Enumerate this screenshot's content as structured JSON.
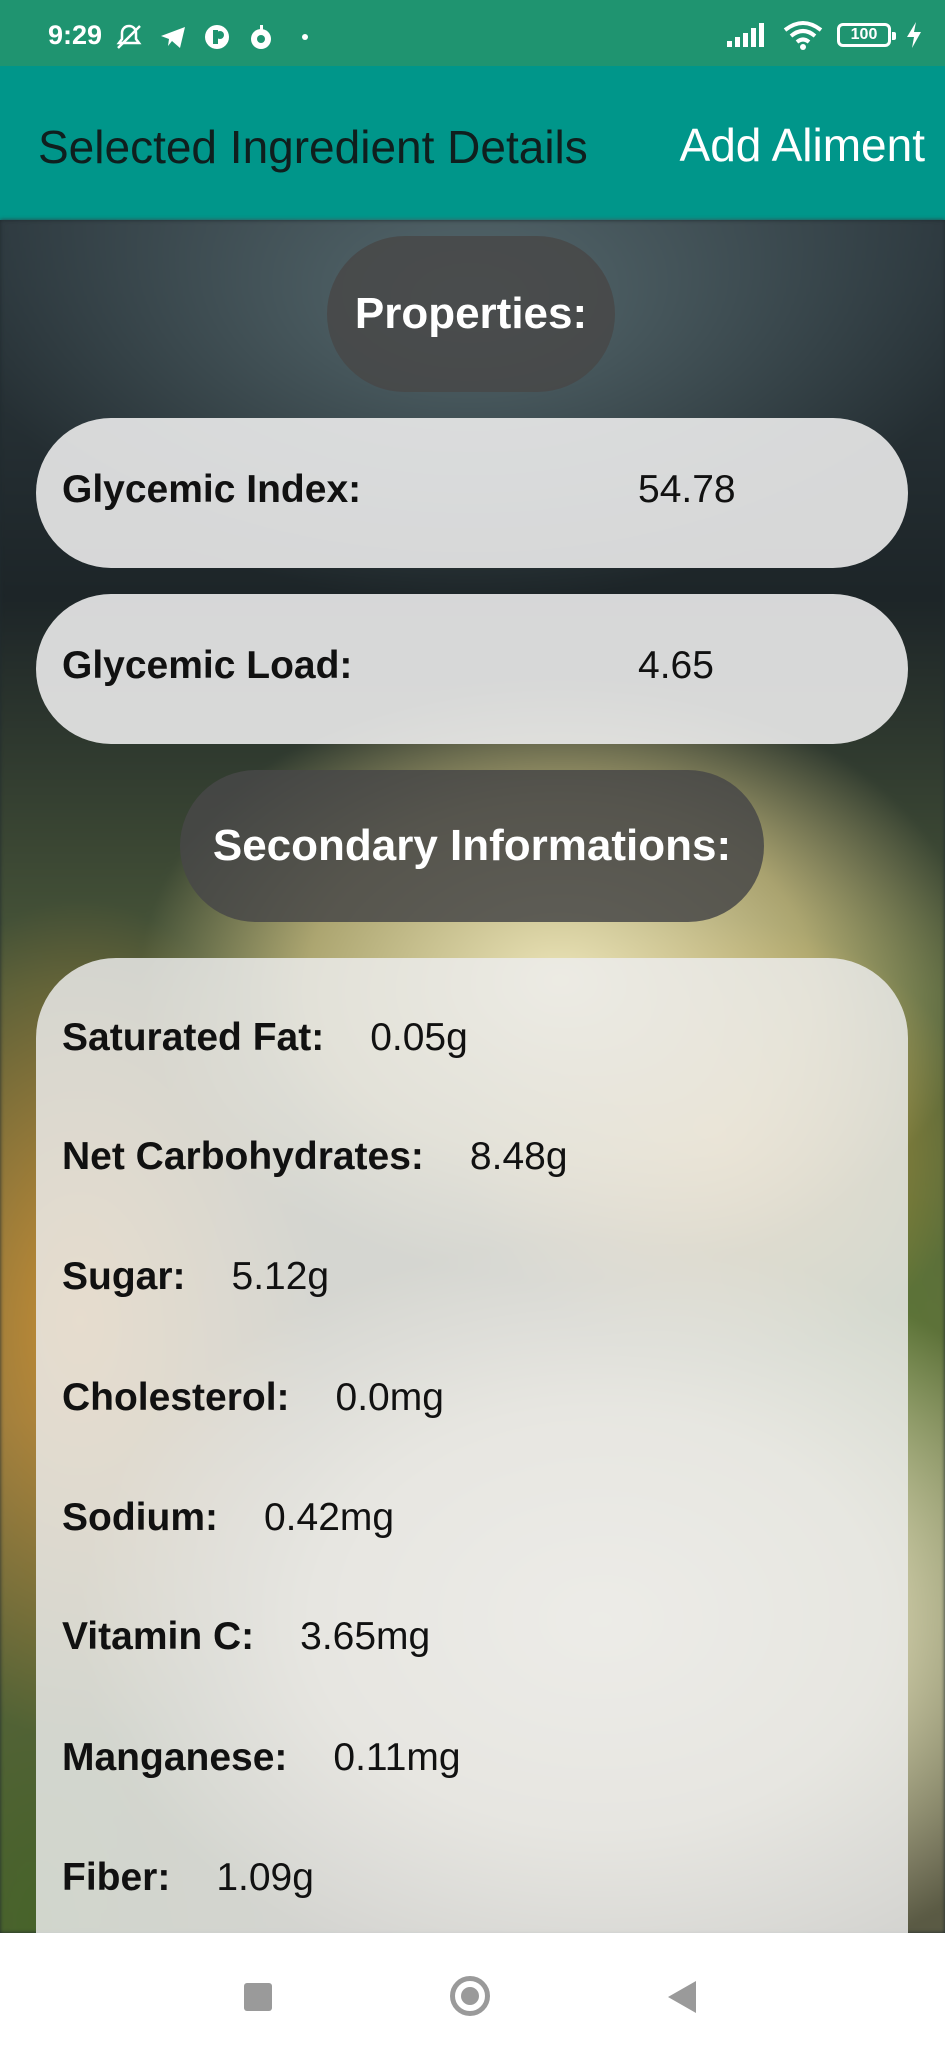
{
  "status_bar": {
    "time": "9:29",
    "battery": "100",
    "left_icons": [
      "bell-off-icon",
      "telegram-icon",
      "app-icon",
      "apple-icon",
      "dot-icon"
    ],
    "right_icons": [
      "signal-icon",
      "wifi-icon",
      "battery-icon",
      "charging-icon"
    ]
  },
  "app_bar": {
    "title": "Selected Ingredient Details",
    "action": "Add Aliment",
    "color": "#00968a"
  },
  "properties": {
    "heading": "Properties:",
    "glycemic_index": {
      "label": "Glycemic Index:",
      "value": "54.78"
    },
    "glycemic_load": {
      "label": "Glycemic Load:",
      "value": "4.65"
    }
  },
  "secondary": {
    "heading": "Secondary Informations:",
    "items": [
      {
        "label": "Saturated Fat:",
        "value": "0.05g"
      },
      {
        "label": "Net Carbohydrates:",
        "value": "8.48g"
      },
      {
        "label": "Sugar:",
        "value": "5.12g"
      },
      {
        "label": "Cholesterol:",
        "value": "0.0mg"
      },
      {
        "label": "Sodium:",
        "value": "0.42mg"
      },
      {
        "label": "Vitamin C:",
        "value": "3.65mg"
      },
      {
        "label": "Manganese:",
        "value": "0.11mg"
      },
      {
        "label": "Fiber:",
        "value": "1.09g"
      }
    ]
  },
  "nav_bar": {
    "icons": [
      "recents-icon",
      "home-icon",
      "back-icon"
    ]
  }
}
